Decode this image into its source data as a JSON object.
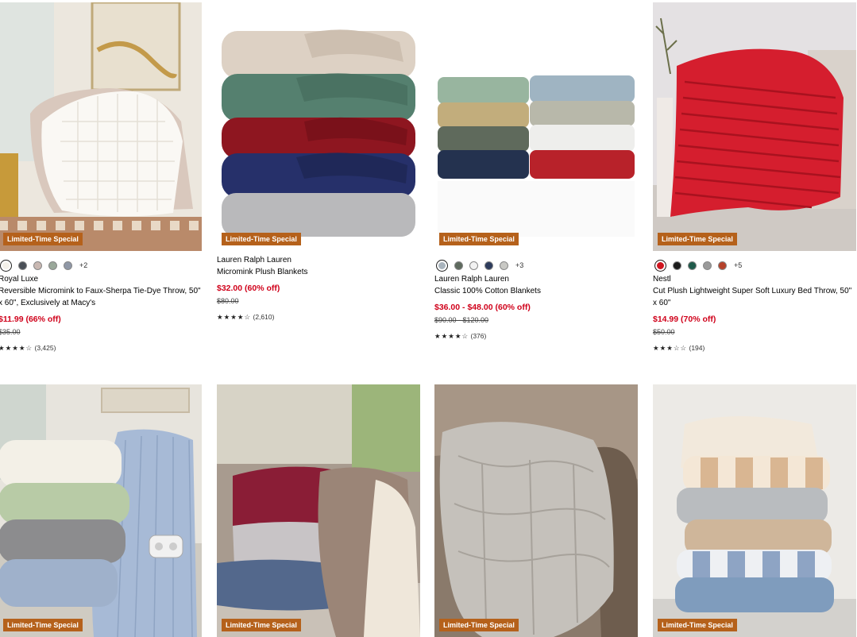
{
  "badge": "Limited-Time Special",
  "products": [
    {
      "brand": "Royal Luxe",
      "title": "Reversible Micromink to Faux-Sherpa Tie-Dye Throw, 50\" x 60\", Exclusively at Macy's",
      "price": "$11.99 (66% off)",
      "original": "$35.00",
      "stars": "★★★★☆",
      "reviews": "(3,425)",
      "more_colors": "+2",
      "swatches": [
        "#f4f1ea",
        "#4a4f57",
        "#c9b8b2",
        "#9aa89a",
        "#8f97a6"
      ]
    },
    {
      "brand": "Lauren Ralph Lauren",
      "title": "Micromink Plush Blankets",
      "price": "$32.00 (60% off)",
      "original": "$80.00",
      "stars": "★★★★☆",
      "reviews": "(2,610)"
    },
    {
      "brand": "Lauren Ralph Lauren",
      "title": "Classic 100% Cotton Blankets",
      "price": "$36.00 - $48.00 (60% off)",
      "original": "$90.00 - $120.00",
      "stars": "★★★★☆",
      "reviews": "(376)",
      "more_colors": "+3",
      "swatches": [
        "#a9b4bd",
        "#5e6a5e",
        "#f2f2f2",
        "#2d3b5c",
        "#c8c8c4"
      ]
    },
    {
      "brand": "Nestl",
      "title": "Cut Plush Lightweight Super Soft Luxury Bed Throw, 50\" x 60\"",
      "price": "$14.99 (70% off)",
      "original": "$50.00",
      "stars": "★★★☆☆",
      "reviews": "(194)",
      "more_colors": "+5",
      "swatches": [
        "#d0141f",
        "#1c1c1c",
        "#1e5a4a",
        "#9a9a9a",
        "#b5412a"
      ]
    }
  ]
}
